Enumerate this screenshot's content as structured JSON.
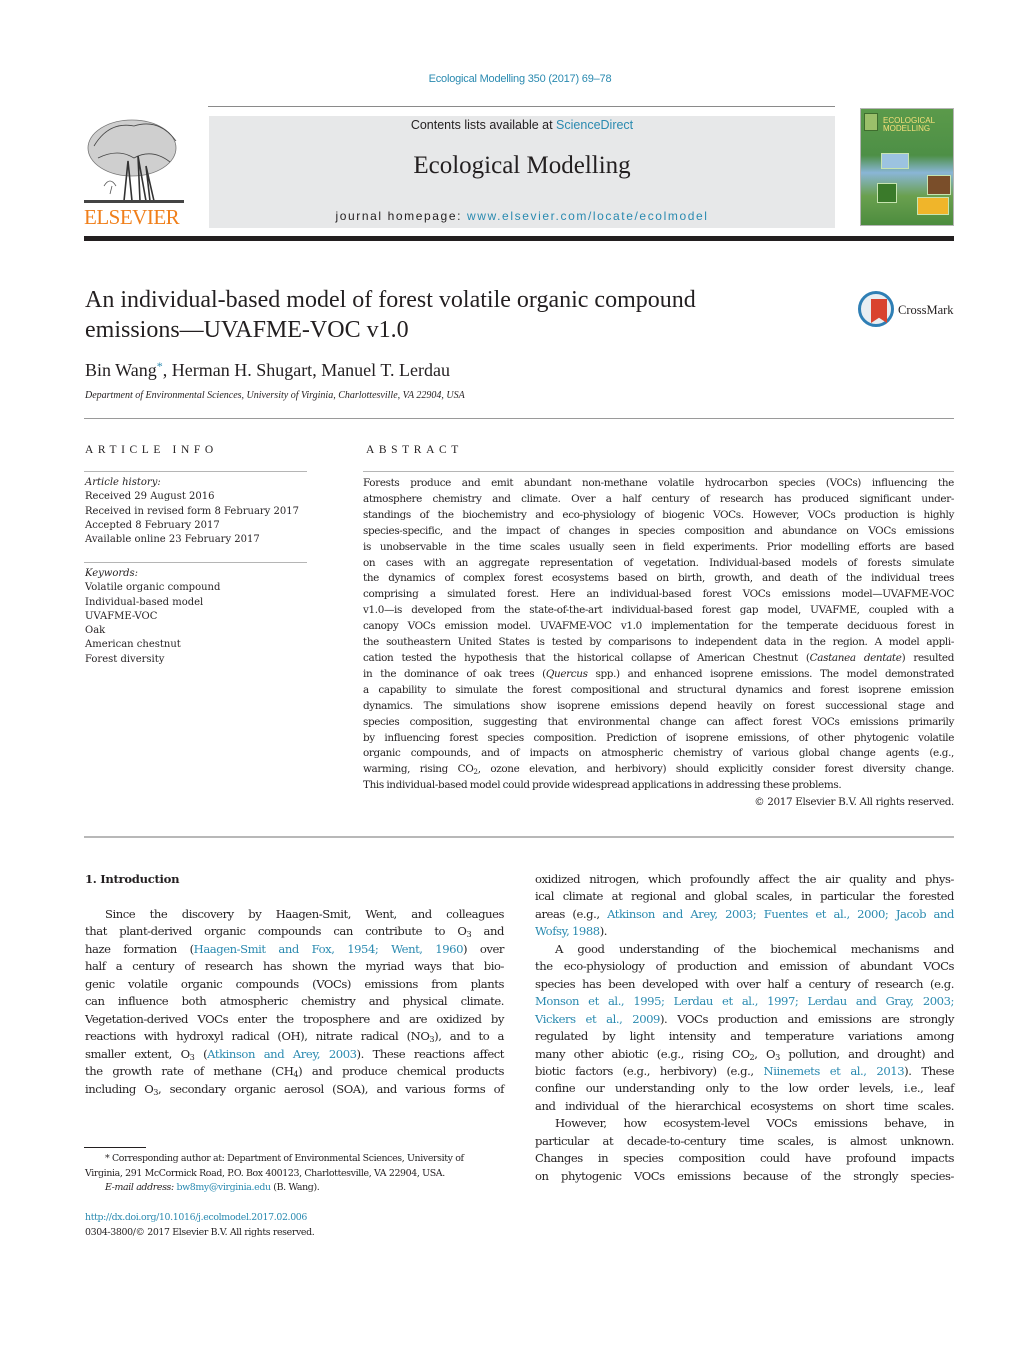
{
  "header": {
    "citation": "Ecological Modelling 350 (2017) 69–78",
    "publisher_logo_text": "ELSEVIER",
    "contents_prefix": "Contents lists available at ",
    "contents_link": "ScienceDirect",
    "journal_title": "Ecological Modelling",
    "homepage_prefix": "journal homepage: ",
    "homepage_link": "www.elsevier.com/locate/ecolmodel",
    "cover_title_line1": "ECOLOGICAL",
    "cover_title_line2": "MODELLING"
  },
  "article": {
    "title_line1": "An individual-based model of forest volatile organic compound",
    "title_line2": "emissions—UVAFME-VOC v1.0",
    "crossmark_label": "CrossMark",
    "authors": [
      {
        "name": "Bin Wang",
        "corresponding_mark": "*"
      },
      {
        "name": "Herman H. Shugart"
      },
      {
        "name": "Manuel T. Lerdau"
      }
    ],
    "author_sep": ", ",
    "affiliation": "Department of Environmental Sciences, University of Virginia, Charlottesville, VA 22904, USA"
  },
  "article_info": {
    "heading": "ARTICLE INFO",
    "history_label": "Article history:",
    "history": [
      "Received 29 August 2016",
      "Received in revised form 8 February 2017",
      "Accepted 8 February 2017",
      "Available online 23 February 2017"
    ],
    "keywords_label": "Keywords:",
    "keywords": [
      "Volatile organic compound",
      "Individual-based model",
      "UVAFME-VOC",
      "Oak",
      "American chestnut",
      "Forest diversity"
    ]
  },
  "abstract": {
    "heading": "ABSTRACT",
    "lines": [
      "Forests produce and emit abundant non-methane volatile hydrocarbon species (VOCs) influencing the",
      "atmosphere chemistry and climate. Over a half century of research has produced significant under-",
      "standings of the biochemistry and eco-physiology of biogenic VOCs. However, VOCs production is highly",
      "species-specific, and the impact of changes in species composition and abundance on VOCs emissions",
      "is unobservable in the time scales usually seen in field experiments. Prior modelling efforts are based",
      "on cases with an aggregate representation of vegetation. Individual-based models of forests simulate",
      "the dynamics of complex forest ecosystems based on birth, growth, and death of the individual trees",
      "comprising a simulated forest. Here an individual-based forest VOCs emissions model—UVAFME-VOC",
      "v1.0—is developed from the state-of-the-art individual-based forest gap model, UVAFME, coupled with a",
      "canopy VOCs emission model. UVAFME-VOC v1.0 implementation for the temperate deciduous forest in",
      "the southeastern United States is tested by comparisons to independent data in the region. A model appli-"
    ],
    "line12_pre": "cation tested the hypothesis that the historical collapse of American Chestnut (",
    "line12_italic": "Castanea dentate",
    "line12_post": ") resulted",
    "line13_pre": "in the dominance of oak trees (",
    "line13_italic": "Quercus",
    "line13_post": " spp.) and enhanced isoprene emissions. The model demonstrated",
    "lines_after": [
      "a capability to simulate the forest compositional and structural dynamics and forest isoprene emission",
      "dynamics. The simulations show isoprene emissions depend heavily on forest successional stage and",
      "species composition, suggesting that environmental change can affect forest VOCs emissions primarily",
      "by influencing forest species composition. Prediction of isoprene emissions, of other phytogenic volatile",
      "organic compounds, and of impacts on atmospheric chemistry of various global change agents (e.g.,"
    ],
    "line19_pre": "warming, rising CO",
    "line19_sub": "2",
    "line19_post": ", ozone elevation, and herbivory) should explicitly consider forest diversity change.",
    "last_line": "This individual-based model could provide widespread applications in addressing these problems.",
    "copyright": "© 2017 Elsevier B.V. All rights reserved."
  },
  "introduction": {
    "heading": "1.  Introduction",
    "left": {
      "l1": "Since the discovery by Haagen-Smit, Went, and colleagues",
      "l2_pre": "that plant-derived organic compounds can contribute to O",
      "l2_sub": "3",
      "l2_post": " and",
      "l3_pre": "haze formation (",
      "l3_link": "Haagen-Smit and Fox, 1954; Went, 1960",
      "l3_post": ") over",
      "l4": "half a century of research has shown the myriad ways that bio-",
      "l5": "genic volatile organic compounds (VOCs) emissions from plants",
      "l6": "can influence both atmospheric chemistry and physical climate.",
      "l7": "Vegetation-derived VOCs enter the troposphere and are oxidized by",
      "l8_pre": "reactions with hydroxyl radical (OH), nitrate radical (NO",
      "l8_sub": "3",
      "l8_post": "), and to a",
      "l9_pre": "smaller extent, O",
      "l9_sub": "3",
      "l9_mid": " (",
      "l9_link": "Atkinson and Arey, 2003",
      "l9_post": "). These reactions affect",
      "l10_pre": "the growth rate of methane (CH",
      "l10_sub": "4",
      "l10_post": ") and produce chemical products",
      "l11_pre": "including O",
      "l11_sub": "3",
      "l11_post": ", secondary organic aerosol (SOA), and various forms of"
    },
    "right": {
      "r1": "oxidized nitrogen, which profoundly affect the air quality and phys-",
      "r2": "ical climate at regional and global scales, in particular the forested",
      "r3_pre": "areas (e.g., ",
      "r3_link": "Atkinson and Arey, 2003; Fuentes et al., 2000; Jacob and",
      "r4_link": "Wofsy, 1988",
      "r4_post": ").",
      "r5": "A good understanding of the biochemical mechanisms and",
      "r6": "the eco-physiology of production and emission of abundant VOCs",
      "r7": "species has been developed with over half a century of research (e.g.",
      "r8_link": "Monson et al., 1995; Lerdau et al., 1997; Lerdau and Gray, 2003;",
      "r9_link": "Vickers et al., 2009",
      "r9_post": "). VOCs production and emissions are strongly",
      "r10": "regulated by light intensity and temperature variations among",
      "r11_pre": "many other abiotic (e.g., rising CO",
      "r11_sub1": "2",
      "r11_mid": ", O",
      "r11_sub2": "3",
      "r11_post": " pollution, and drought) and",
      "r12_pre": "biotic factors (e.g., herbivory) (e.g., ",
      "r12_link": "Niinemets et al., 2013",
      "r12_post": "). These",
      "r13": "confine our understanding only to the low order levels, i.e., leaf",
      "r14": "and individual of the hierarchical ecosystems on short time scales.",
      "r15": "However, how ecosystem-level VOCs emissions behave, in",
      "r16": "particular at decade-to-century time scales, is almost unknown.",
      "r17": "Changes in species composition could have profound impacts",
      "r18": "on phytogenic VOCs emissions because of the strongly species-"
    }
  },
  "footnotes": {
    "corresponding_line1": "*  Corresponding author at: Department of Environmental Sciences, University of",
    "corresponding_line2": "Virginia, 291 McCormick Road, P.O. Box 400123, Charlottesville, VA 22904, USA.",
    "email_label": "E-mail address: ",
    "email": "bw8my@virginia.edu",
    "email_suffix": " (B. Wang).",
    "doi": "http://dx.doi.org/10.1016/j.ecolmodel.2017.02.006",
    "issn": "0304-3800/© 2017 Elsevier B.V. All rights reserved."
  },
  "colors": {
    "link": "#2a8ab0",
    "elsevier_orange": "#f07f1a",
    "banner_gray": "#e7e8e9",
    "text": "#231f20"
  }
}
